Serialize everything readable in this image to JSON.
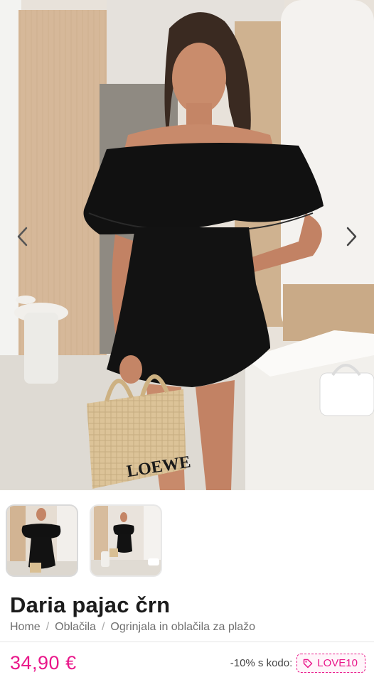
{
  "gallery": {
    "prev_icon": "chevron-left-icon",
    "next_icon": "chevron-right-icon",
    "hero_bag_text": "LOEWE",
    "thumbnails": [
      {
        "name": "thumbnail-1",
        "active": true
      },
      {
        "name": "thumbnail-2",
        "active": false
      }
    ]
  },
  "product": {
    "title": "Daria pajac črn",
    "breadcrumb": [
      "Home",
      "Oblačila",
      "Ogrinjala in oblačila za plažo"
    ],
    "breadcrumb_separator": "/",
    "price": "34,90 €",
    "promo_text": "-10% s kodo:",
    "promo_code": "LOVE10",
    "tag_icon": "tag-icon"
  },
  "colors": {
    "accent": "#e9178a",
    "dress": "#111111",
    "wall_wood": "#d3b697"
  }
}
